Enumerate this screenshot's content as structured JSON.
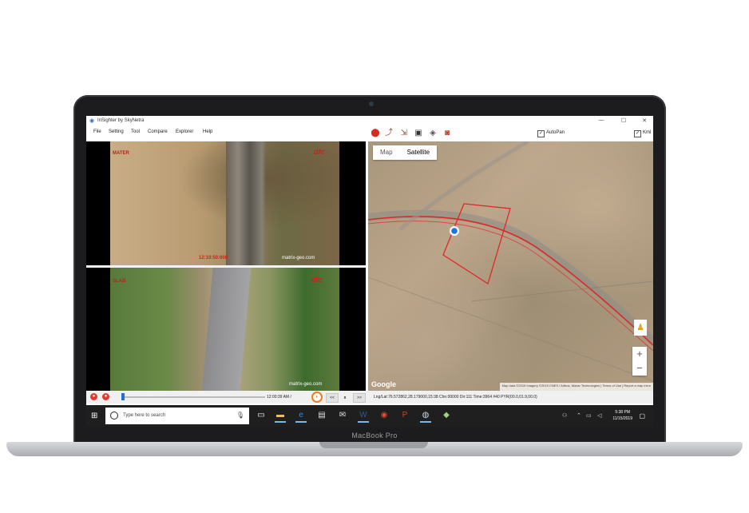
{
  "window": {
    "title": "InSighter by SkyNetra",
    "controls": {
      "minimize": "—",
      "maximize": "☐",
      "close": "✕"
    }
  },
  "menu": [
    "File",
    "Setting",
    "Tool",
    "Compare",
    "Explorer",
    "Help"
  ],
  "toolbar": {
    "icons": [
      "map-pin-icon",
      "route-icon",
      "export-icon",
      "save-icon",
      "tag-icon",
      "camera-icon"
    ],
    "autopan_label": "AutoPan",
    "autopan_checked": true,
    "kml_label": "Kml",
    "kml_checked": true
  },
  "video": {
    "top_overlay": "12:10:50:000",
    "top_logo": "dfc",
    "top_watermark": "matrix-geo.com",
    "top_corner_text": "MATER",
    "bottom_corner_text": "SLAB",
    "bottom_logo": "dfc",
    "bottom_watermark": "matrix-geo.com"
  },
  "map": {
    "type_options": [
      "Map",
      "Satellite"
    ],
    "selected_type": "Satellite",
    "zoom_in": "+",
    "zoom_out": "−",
    "google_label": "Google",
    "attribution": "Map data ©2019 Imagery ©2019 CNES / Airbus, Maxar Technologies | Terms of Use | Report a map error"
  },
  "player": {
    "progress": 0.0,
    "time": "12:00:39 AM /",
    "prev_label": "<<",
    "speed_label": "x",
    "next_label": ">>",
    "status": "Lng/Lat:76.572862,28.179000,15:38 Chn:00000 Dir:111 Time:3964 #40 PYR(00.0,01.9,00.0)"
  },
  "taskbar": {
    "search_placeholder": "Type here to search",
    "time": "5:38 PM",
    "date": "11/15/2019"
  },
  "device_label": "MacBook Pro"
}
